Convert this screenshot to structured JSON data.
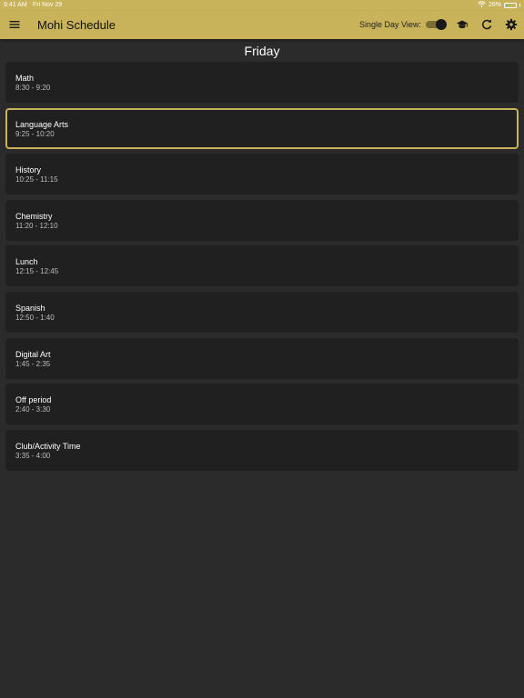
{
  "status_bar": {
    "time": "9:41 AM",
    "date": "Fri Nov 29",
    "battery": "26%",
    "battery_level": 0.26
  },
  "header": {
    "title": "Mohi Schedule",
    "single_day_label": "Single Day View:",
    "single_day_enabled": true,
    "icons": [
      "menu-icon",
      "graduation-cap-icon",
      "refresh-icon",
      "gear-icon"
    ]
  },
  "day": {
    "name": "Friday"
  },
  "periods": [
    {
      "name": "Math",
      "time": "8:30 - 9:20"
    },
    {
      "name": "Language Arts",
      "time": "9:25 - 10:20",
      "current": true
    },
    {
      "name": "History",
      "time": "10:25 - 11:15"
    },
    {
      "name": "Chemistry",
      "time": "11:20 - 12:10"
    },
    {
      "name": "Lunch",
      "time": "12:15 - 12:45"
    },
    {
      "name": "Spanish",
      "time": "12:50 - 1:40"
    },
    {
      "name": "Digital Art",
      "time": "1:45 - 2:35"
    },
    {
      "name": "Off period",
      "time": "2:40 - 3:30"
    },
    {
      "name": "Club/Activity Time",
      "time": "3:35 - 4:00"
    }
  ],
  "colors": {
    "accent": "#c8b35a",
    "background": "#2b2b2b",
    "card": "#202020"
  }
}
